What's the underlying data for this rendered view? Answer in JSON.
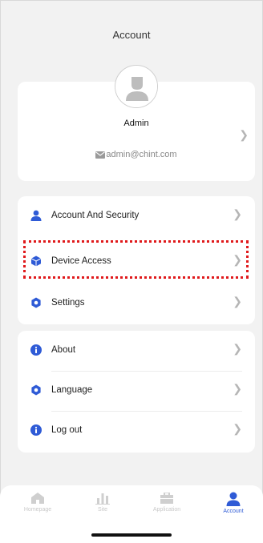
{
  "header": {
    "title": "Account"
  },
  "profile": {
    "name": "Admin",
    "email": "admin@chint.com"
  },
  "menu_group_1": [
    {
      "label": "Account And Security",
      "icon": "user-icon"
    },
    {
      "label": "Device Access",
      "icon": "cube-icon",
      "highlighted": true
    },
    {
      "label": "Settings",
      "icon": "gear-icon"
    }
  ],
  "menu_group_2": [
    {
      "label": "About",
      "icon": "info-icon"
    },
    {
      "label": "Language",
      "icon": "gear-icon"
    },
    {
      "label": "Log out",
      "icon": "info-icon"
    }
  ],
  "tabbar": [
    {
      "label": "Homepage",
      "icon": "home-icon",
      "active": false
    },
    {
      "label": "Site",
      "icon": "bar-chart-icon",
      "active": false
    },
    {
      "label": "Application",
      "icon": "briefcase-icon",
      "active": false
    },
    {
      "label": "Account",
      "icon": "user-icon",
      "active": true
    }
  ],
  "colors": {
    "accent": "#2f5bd6",
    "highlight_border": "#e0191b",
    "background": "#f2f2f2"
  }
}
